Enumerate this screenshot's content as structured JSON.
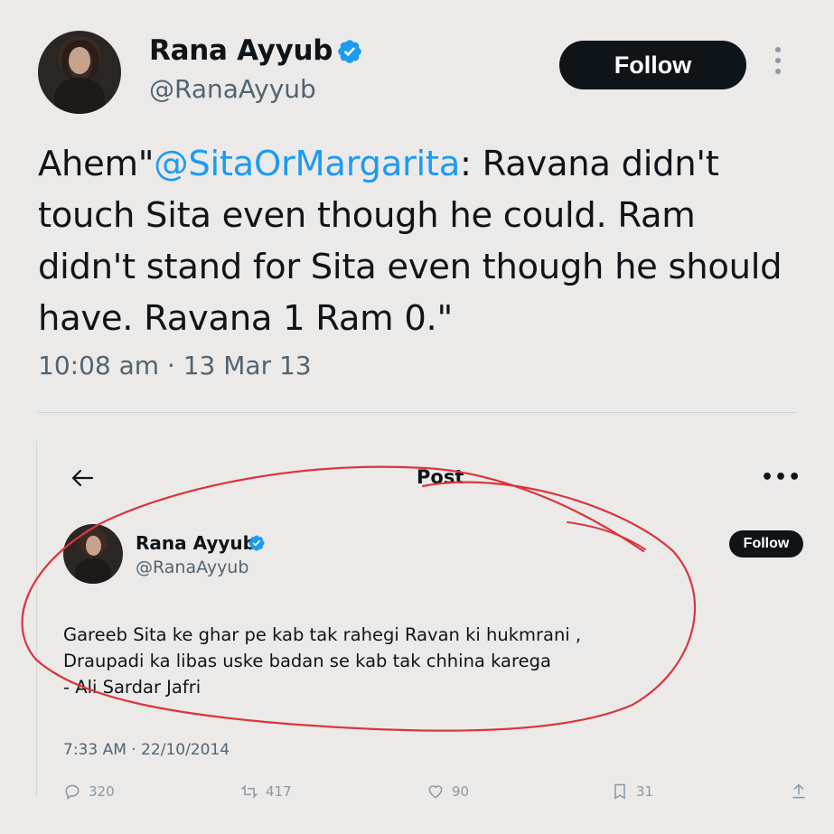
{
  "main_tweet": {
    "author_name": "Rana Ayyub",
    "handle": "@RanaAyyub",
    "follow_label": "Follow",
    "text_prefix": "Ahem\"",
    "mention": "@SitaOrMargarita",
    "text_line1_rest": ": Ravana didn't",
    "text_line2": "touch Sita even though he could. Ram",
    "text_line3": "didn't stand for Sita even though he should",
    "text_line4": "have. Ravana 1 Ram 0.\"",
    "timestamp": "10:08 am · 13 Mar 13"
  },
  "embedded_post": {
    "header_title": "Post",
    "more_glyph": "•••",
    "author_name": "Rana Ayyub",
    "handle": "@RanaAyyub",
    "follow_label": "Follow",
    "text_lines": [
      "Gareeb Sita ke ghar pe kab tak rahegi Ravan ki hukmrani ,",
      "Draupadi ka libas uske badan se kab tak chhina karega",
      "- Ali Sardar Jafri"
    ],
    "timestamp": "7:33 AM · 22/10/2014",
    "stats": {
      "replies": "320",
      "reposts": "417",
      "likes": "90",
      "bookmarks": "31"
    }
  },
  "colors": {
    "background": "#ebeae9",
    "text": "#0f1419",
    "secondary": "#536471",
    "link": "#1d9bf0",
    "verified": "#1d9bf0",
    "annotation_ink": "#d9363e"
  },
  "icons": [
    "verified-badge-icon",
    "more-vertical-icon",
    "back-arrow-icon",
    "more-horizontal-icon",
    "reply-icon",
    "repost-icon",
    "like-icon",
    "bookmark-icon",
    "share-icon"
  ]
}
